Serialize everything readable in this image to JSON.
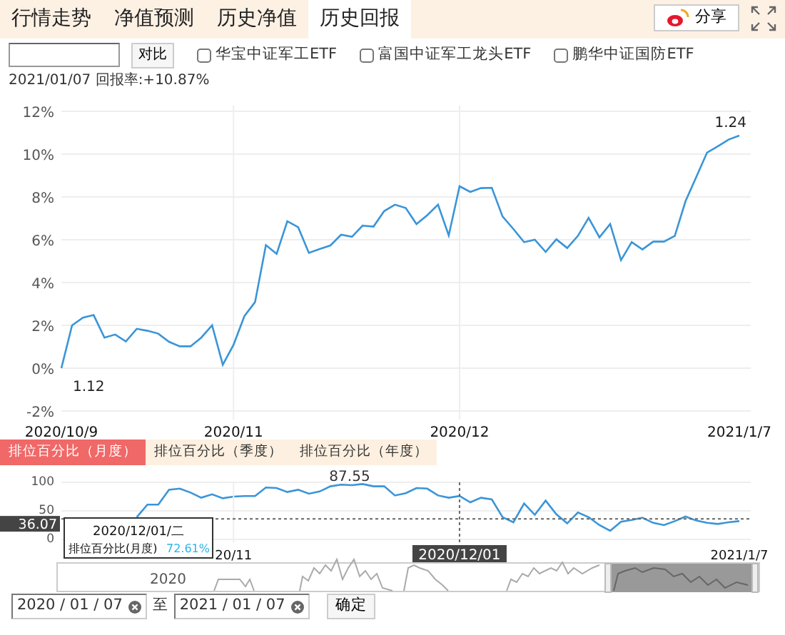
{
  "tabs": [
    {
      "label": "行情走势",
      "selected": false
    },
    {
      "label": "净值预测",
      "selected": false
    },
    {
      "label": "历史净值",
      "selected": false
    },
    {
      "label": "历史回报",
      "selected": true
    }
  ],
  "share_button": {
    "label": "分享"
  },
  "compare": {
    "button": "对比",
    "funds": [
      {
        "label": "华宝中证军工ETF",
        "checked": false
      },
      {
        "label": "富国中证军工龙头ETF",
        "checked": false
      },
      {
        "label": "鹏华中证国防ETF",
        "checked": false
      }
    ]
  },
  "return_info": "2021/01/07 回报率:+10.87%",
  "return_chart": {
    "chart_data": {
      "type": "line",
      "ylim": [
        -2,
        12
      ],
      "grid": true,
      "categories": [
        "2020/10/9",
        null,
        null,
        null,
        null,
        null,
        null,
        null,
        null,
        null,
        null,
        null,
        null,
        null,
        null,
        null,
        "2020/11",
        null,
        null,
        null,
        null,
        null,
        null,
        null,
        null,
        null,
        null,
        null,
        null,
        null,
        null,
        null,
        null,
        null,
        null,
        null,
        null,
        "2020/12",
        null,
        null,
        null,
        null,
        null,
        null,
        null,
        null,
        null,
        null,
        null,
        null,
        null,
        null,
        null,
        null,
        null,
        null,
        null,
        null,
        null,
        null,
        null,
        null,
        null,
        "2021/1/7"
      ],
      "yticks": [
        {
          "value": -2,
          "label": "-2%"
        },
        {
          "value": 0,
          "label": "0%"
        },
        {
          "value": 2,
          "label": "2%"
        },
        {
          "value": 4,
          "label": "4%"
        },
        {
          "value": 6,
          "label": "6%"
        },
        {
          "value": 8,
          "label": "8%"
        },
        {
          "value": 10,
          "label": "10%"
        },
        {
          "value": 12,
          "label": "12%"
        }
      ],
      "series": [
        {
          "color": "#3a95d8",
          "values": [
            0,
            2.0,
            2.36,
            2.48,
            1.43,
            1.57,
            1.25,
            1.84,
            1.75,
            1.61,
            1.23,
            1.02,
            1.02,
            1.43,
            2.0,
            0.16,
            1.09,
            2.43,
            3.09,
            5.75,
            5.34,
            6.86,
            6.59,
            5.39,
            5.57,
            5.73,
            6.23,
            6.14,
            6.66,
            6.61,
            7.34,
            7.64,
            7.48,
            6.73,
            7.14,
            7.64,
            6.2,
            8.5,
            8.23,
            8.41,
            8.43,
            7.09,
            6.5,
            5.89,
            6.0,
            5.43,
            6.02,
            5.61,
            6.18,
            7.02,
            6.11,
            6.73,
            5.05,
            5.89,
            5.55,
            5.91,
            5.91,
            6.18,
            7.8,
            8.93,
            10.07,
            10.36,
            10.68,
            10.87
          ]
        }
      ],
      "annotations": [
        {
          "x": "2020/10/9",
          "y": 0,
          "text": "1.12"
        },
        {
          "x": "2021/1/7",
          "y": 10.87,
          "text": "1.24"
        }
      ]
    }
  },
  "rank_tabs": [
    {
      "label": "排位百分比（月度）",
      "selected": true
    },
    {
      "label": "排位百分比（季度）",
      "selected": false
    },
    {
      "label": "排位百分比（年度）",
      "selected": false
    }
  ],
  "rank_chart": {
    "chart_data": {
      "type": "line",
      "ylim": [
        0,
        100
      ],
      "yticks": [
        0,
        50,
        100
      ],
      "grid": true,
      "categories": [
        null,
        null,
        null,
        null,
        null,
        null,
        null,
        null,
        null,
        null,
        null,
        null,
        null,
        null,
        null,
        null,
        "20/11",
        null,
        null,
        null,
        null,
        null,
        null,
        null,
        null,
        null,
        null,
        null,
        null,
        null,
        null,
        null,
        null,
        null,
        null,
        null,
        null,
        "2020/12/01",
        null,
        null,
        null,
        null,
        null,
        null,
        null,
        null,
        null,
        null,
        null,
        null,
        null,
        null,
        null,
        null,
        null,
        null,
        null,
        null,
        null,
        null,
        null,
        null,
        null,
        "2021/1/7"
      ],
      "series": [
        {
          "color": "#3a95d8",
          "values": [
            null,
            null,
            null,
            null,
            null,
            null,
            null,
            39,
            61,
            61,
            87,
            89,
            82,
            73,
            79,
            72,
            75,
            76,
            76,
            91,
            90,
            83,
            87,
            80,
            84,
            93,
            96,
            95,
            97,
            93,
            93,
            77,
            81,
            90,
            89,
            77,
            73,
            76,
            65,
            73,
            70,
            39,
            30,
            63,
            43,
            68,
            44,
            28,
            47,
            39,
            25,
            15,
            31,
            34,
            38,
            29,
            25,
            32,
            40,
            33,
            29,
            27,
            30,
            32
          ]
        }
      ],
      "annotations": [
        "87.55"
      ],
      "ref_lines": [
        {
          "axis": "y",
          "value": 36.07,
          "label": "36.07"
        },
        {
          "axis": "x",
          "value": "2020/12/01"
        }
      ]
    },
    "tooltip": {
      "date": "2020/12/01/二",
      "label": "排位百分比(月度)",
      "value": "72.61%"
    }
  },
  "navigator": {
    "year_label": "2020"
  },
  "date_range": {
    "from": "2020 / 01 / 07",
    "separator": "至",
    "to": "2021 / 01 / 07",
    "button": "确定"
  }
}
